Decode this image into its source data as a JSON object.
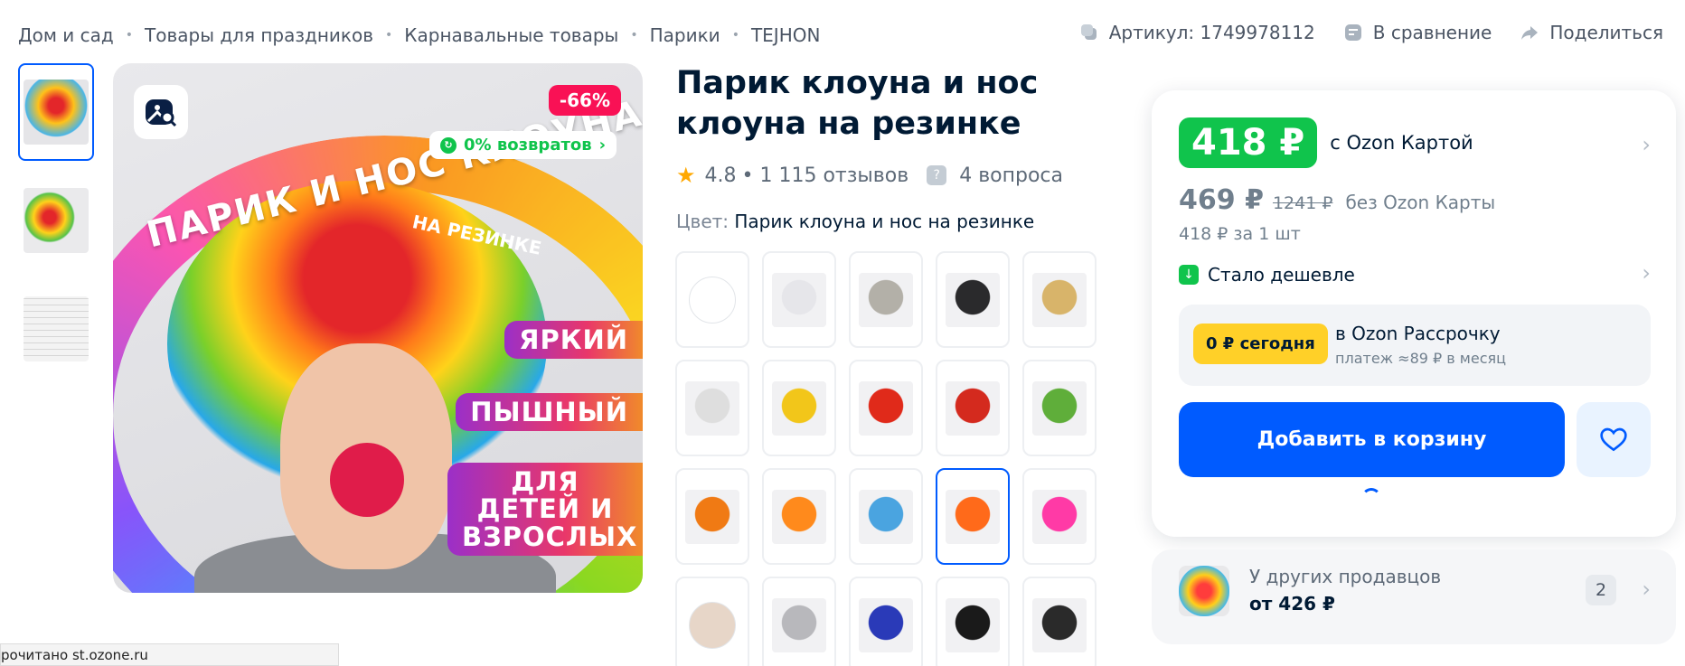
{
  "breadcrumb": [
    "Дом и сад",
    "Товары для праздников",
    "Карнавальные товары",
    "Парики",
    "TEJHON"
  ],
  "top_actions": {
    "article": "Артикул: 1749978112",
    "compare": "В сравнение",
    "share": "Поделиться"
  },
  "gallery": {
    "discount": "-66%",
    "returns": "0% возвратов",
    "headline": "ПАРИК И НОС КЛОУНА",
    "subline": "НА РЕЗИНКЕ",
    "tags": [
      "ЯРКИЙ",
      "ПЫШНЫЙ",
      "ДЛЯ ДЕТЕЙ И ВЗРОСЛЫХ"
    ],
    "thumb_count": 3
  },
  "product": {
    "title": "Парик клоуна и нос клоуна на резинке",
    "rating": "4.8",
    "reviews": "• 1 115 отзывов",
    "questions": "4 вопроса",
    "color_label": "Цвет: ",
    "color_value": "Парик клоуна и нос на резинке"
  },
  "variants": [
    {
      "kind": "circle",
      "color": "#ffffff"
    },
    {
      "kind": "pic",
      "color": "#e6e6ea"
    },
    {
      "kind": "pic",
      "color": "#b3b0a8"
    },
    {
      "kind": "pic",
      "color": "#2a2a2c"
    },
    {
      "kind": "pic",
      "color": "#d8b46a"
    },
    {
      "kind": "pic",
      "color": "#dedede"
    },
    {
      "kind": "pic",
      "color": "#f2c61a"
    },
    {
      "kind": "pic",
      "color": "#e02a1a"
    },
    {
      "kind": "pic",
      "color": "#d42a1e"
    },
    {
      "kind": "pic",
      "color": "#5fae3a"
    },
    {
      "kind": "pic",
      "color": "#f07a14"
    },
    {
      "kind": "pic",
      "color": "#ff8a1c"
    },
    {
      "kind": "pic",
      "color": "#4aa4e0"
    },
    {
      "kind": "pic",
      "color": "#ff6a1a",
      "active": true
    },
    {
      "kind": "pic",
      "color": "#ff3aa6"
    },
    {
      "kind": "circle",
      "color": "#e7d6c8"
    },
    {
      "kind": "pic",
      "color": "#b8b8bc"
    },
    {
      "kind": "pic",
      "color": "#2a3ab8"
    },
    {
      "kind": "pic",
      "color": "#1a1a1a"
    },
    {
      "kind": "pic",
      "color": "#2a2a2a"
    }
  ],
  "buy": {
    "price_card": "418 ₽",
    "price_card_label": "с Ozon Картой",
    "price_nocard": "469 ₽",
    "price_original": "1241 ₽",
    "price_nocard_label": "без Ozon Карты",
    "per_unit": "418 ₽ за 1 шт",
    "cheaper": "Стало дешевле",
    "installment_pill": "0 ₽ сегодня",
    "installment_title": "в Ozon Рассрочку",
    "installment_sub": "платеж ≈89 ₽ в месяц",
    "add_to_cart": "Добавить в корзину"
  },
  "other_sellers": {
    "label": "У других продавцов",
    "price": "от 426 ₽",
    "count": "2"
  },
  "status_bar": "рочитано st.ozone.ru",
  "colors": {
    "accent": "#005bff",
    "green": "#10c44c",
    "discount": "#f91155",
    "yellow": "#ffd028"
  }
}
